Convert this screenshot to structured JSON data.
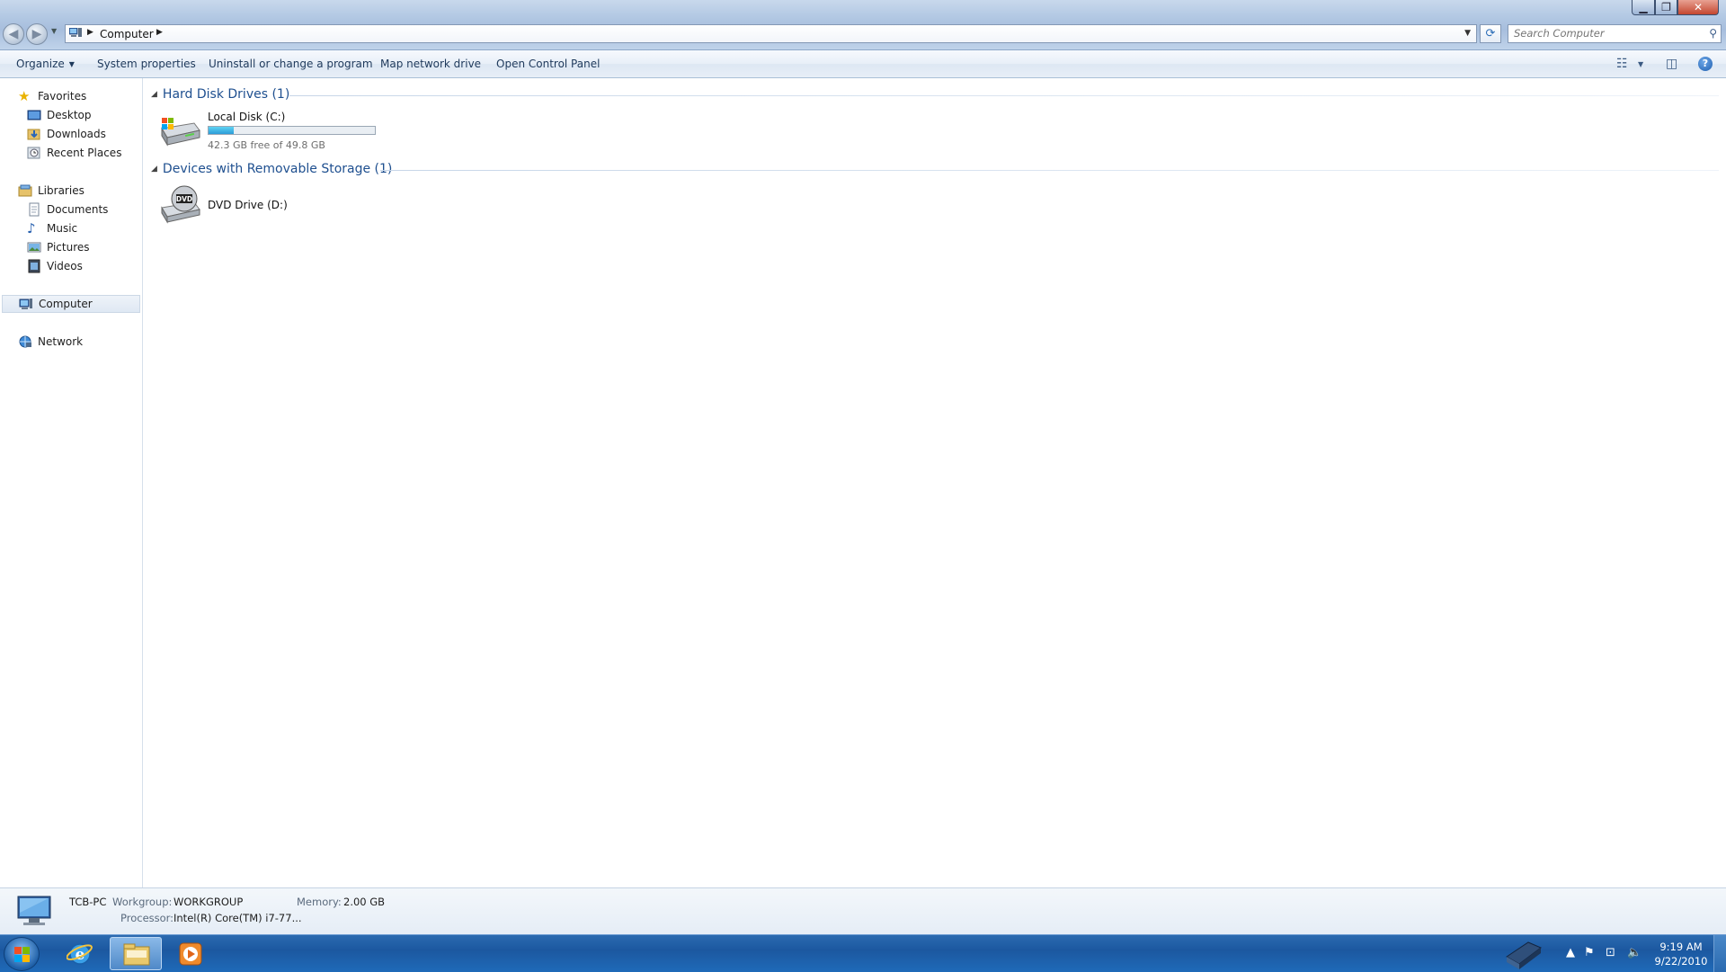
{
  "window": {
    "breadcrumb": [
      "Computer"
    ],
    "search_placeholder": "Search Computer"
  },
  "toolbar": {
    "organize": "Organize",
    "system_properties": "System properties",
    "uninstall": "Uninstall or change a program",
    "map_drive": "Map network drive",
    "control_panel": "Open Control Panel"
  },
  "sidebar": {
    "favorites": "Favorites",
    "desktop": "Desktop",
    "downloads": "Downloads",
    "recent": "Recent Places",
    "libraries": "Libraries",
    "documents": "Documents",
    "music": "Music",
    "pictures": "Pictures",
    "videos": "Videos",
    "computer": "Computer",
    "network": "Network"
  },
  "groups": {
    "hdd_title": "Hard Disk Drives (1)",
    "removable_title": "Devices with Removable Storage (1)"
  },
  "drives": {
    "c_name": "Local Disk (C:)",
    "c_free": "42.3 GB free of 49.8 GB",
    "c_used_fraction": 0.15,
    "d_name": "DVD Drive (D:)",
    "dvd_label": "DVD"
  },
  "details": {
    "pc_name": "TCB-PC",
    "workgroup_label": "Workgroup:",
    "workgroup": "WORKGROUP",
    "memory_label": "Memory:",
    "memory": "2.00 GB",
    "processor_label": "Processor:",
    "processor": "Intel(R) Core(TM) i7-77..."
  },
  "taskbar": {
    "time": "9:19 AM",
    "date": "9/22/2010"
  },
  "colors": {
    "accent": "#1e4f8f",
    "taskbar": "#1c58a0",
    "usage_fill": "#2b9bd8"
  }
}
